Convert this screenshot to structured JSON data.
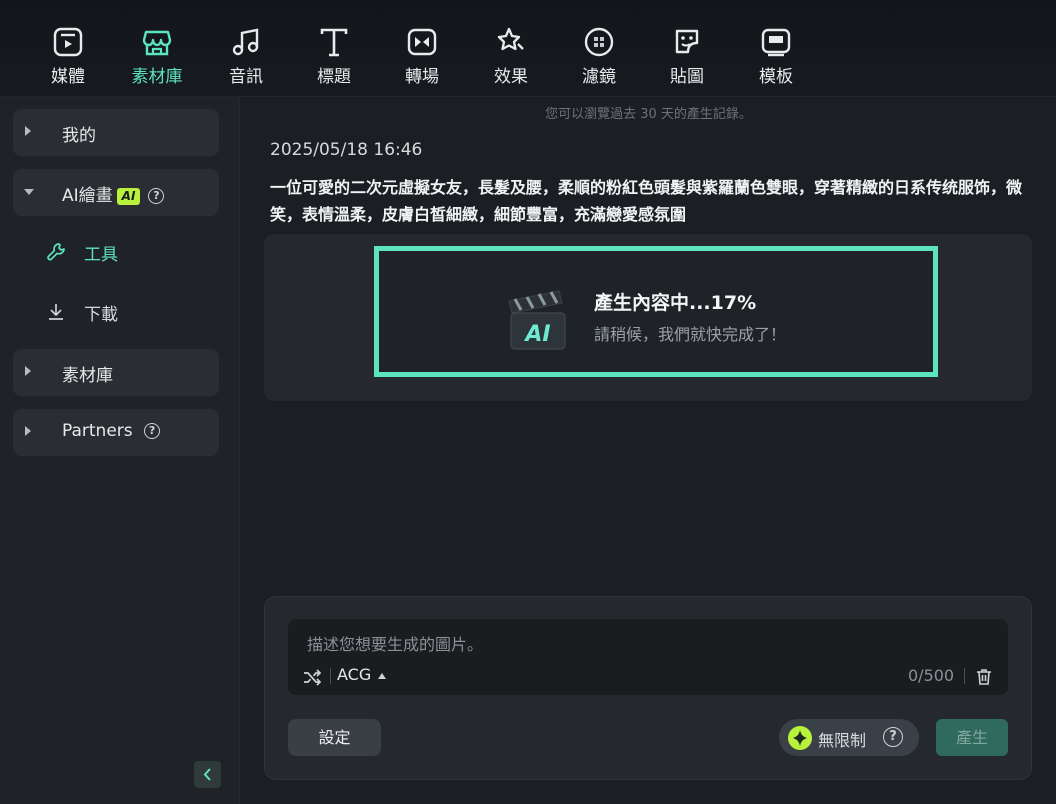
{
  "toolbar": {
    "tabs": [
      {
        "label": "媒體",
        "icon": "media-icon"
      },
      {
        "label": "素材庫",
        "icon": "store-icon",
        "active": true
      },
      {
        "label": "音訊",
        "icon": "music-icon"
      },
      {
        "label": "標題",
        "icon": "title-icon"
      },
      {
        "label": "轉場",
        "icon": "transition-icon"
      },
      {
        "label": "效果",
        "icon": "effects-icon"
      },
      {
        "label": "濾鏡",
        "icon": "filter-icon"
      },
      {
        "label": "貼圖",
        "icon": "sticker-icon"
      },
      {
        "label": "模板",
        "icon": "template-icon"
      }
    ],
    "accent_color": "#5ee3c1"
  },
  "sidebar": {
    "mine": "我的",
    "ai_paint": "AI繪畫",
    "ai_badge": "AI",
    "tools": "工具",
    "download": "下載",
    "library": "素材庫",
    "partners": "Partners"
  },
  "main": {
    "notice": "您可以瀏覽過去 30 天的產生記錄。",
    "timestamp": "2025/05/18 16:46",
    "prompt": "一位可愛的二次元虛擬女友，長髮及腰，柔順的粉紅色頭髮與紫羅蘭色雙眼，穿著精緻的日系传统服饰，微笑，表情溫柔，皮膚白皙細緻，細節豐富，充滿戀愛感氛圍",
    "progress_title": "產生內容中...17%",
    "progress_percent": 17,
    "progress_sub": "請稍候，我們就快完成了！",
    "clapper_text": "AI"
  },
  "input": {
    "placeholder": "描述您想要生成的圖片。",
    "style": "ACG",
    "counter": "0/500",
    "settings_label": "設定",
    "unlimited_label": "無限制",
    "generate_label": "產生"
  }
}
